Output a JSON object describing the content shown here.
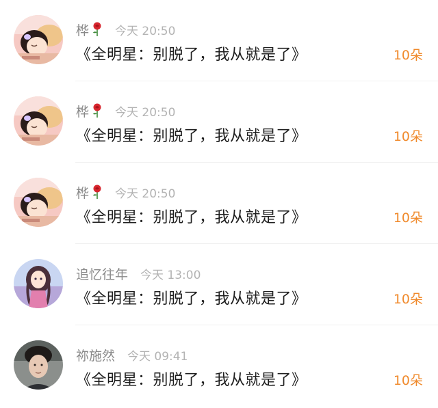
{
  "colors": {
    "accent": "#f08a2c",
    "name": "#8a8a8a",
    "time": "#b3b3b3",
    "text": "#1f1f1f"
  },
  "messages": [
    {
      "avatar": "baby-sleeping-avatar",
      "name": "桦",
      "has_rose": true,
      "time": "今天 20:50",
      "content": "《全明星：别脱了，我从就是了》",
      "amount": "10朵"
    },
    {
      "avatar": "baby-sleeping-avatar",
      "name": "桦",
      "has_rose": true,
      "time": "今天 20:50",
      "content": "《全明星：别脱了，我从就是了》",
      "amount": "10朵"
    },
    {
      "avatar": "baby-sleeping-avatar",
      "name": "桦",
      "has_rose": true,
      "time": "今天 20:50",
      "content": "《全明星：别脱了，我从就是了》",
      "amount": "10朵"
    },
    {
      "avatar": "anime-girl-avatar",
      "name": "追忆往年",
      "has_rose": false,
      "time": "今天 13:00",
      "content": "《全明星：别脱了，我从就是了》",
      "amount": "10朵"
    },
    {
      "avatar": "young-man-avatar",
      "name": "祢施然",
      "has_rose": false,
      "time": "今天 09:41",
      "content": "《全明星：别脱了，我从就是了》",
      "amount": "10朵"
    }
  ]
}
